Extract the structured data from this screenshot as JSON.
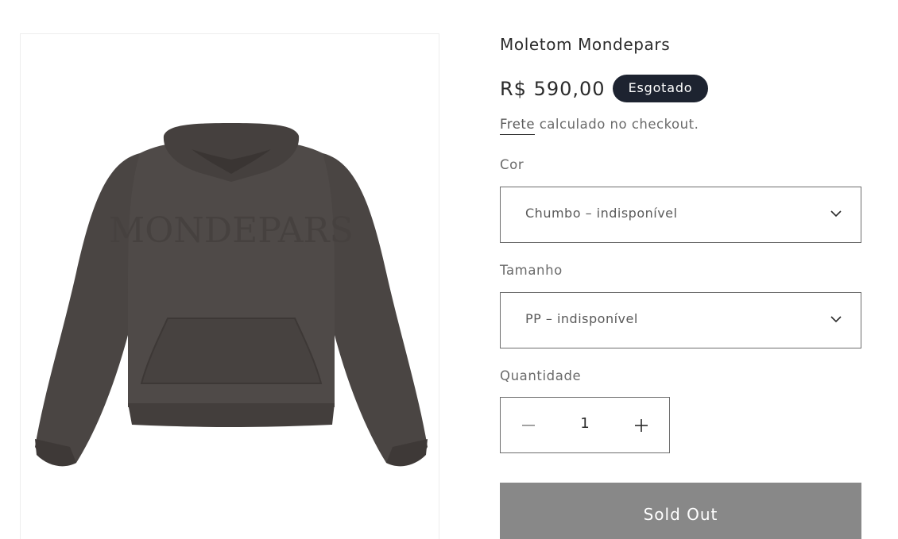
{
  "product": {
    "title": "Moletom Mondepars",
    "price": "R$ 590,00",
    "badge": "Esgotado",
    "image_icon": "hoodie-image",
    "product_color_hex": "#4a4543"
  },
  "shipping": {
    "link_text": "Frete",
    "rest_text": " calculado no checkout."
  },
  "options": {
    "color": {
      "label": "Cor",
      "selected": "Chumbo – indisponível",
      "icon": "chevron-down-icon"
    },
    "size": {
      "label": "Tamanho",
      "selected": "PP – indisponível",
      "icon": "chevron-down-icon"
    }
  },
  "quantity": {
    "label": "Quantidade",
    "value": "1",
    "minus_icon": "minus-icon",
    "plus_icon": "plus-icon"
  },
  "cta": {
    "label": "Sold Out",
    "color": "#888888"
  },
  "colors": {
    "badge_bg": "#1d2330",
    "text": "#2b2b2b",
    "muted": "#6a6a6a"
  }
}
